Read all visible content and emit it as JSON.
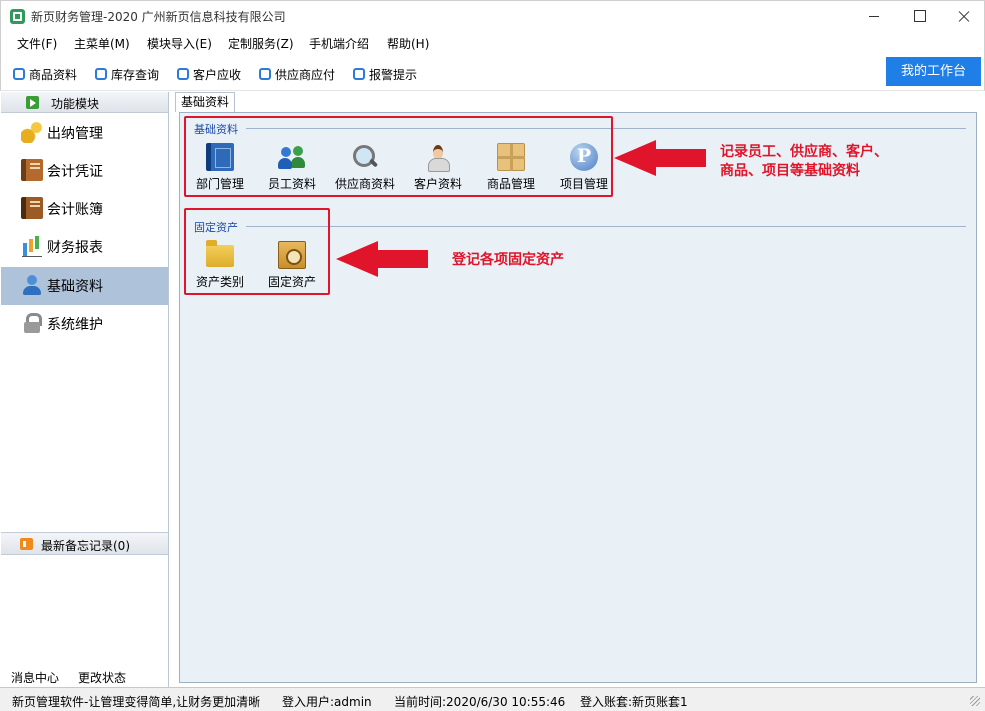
{
  "window": {
    "title": "新页财务管理-2020 广州新页信息科技有限公司"
  },
  "menu": [
    "文件(F)",
    "主菜单(M)",
    "模块导入(E)",
    "定制服务(Z)",
    "手机端介绍",
    "帮助(H)"
  ],
  "toolbar": {
    "quick_links": [
      "商品资料",
      "库存查询",
      "客户应收",
      "供应商应付",
      "报警提示"
    ],
    "workbench_label": "我的工作台"
  },
  "sidebar": {
    "header": "功能模块",
    "modules": [
      {
        "label": "出纳管理",
        "icon": "coins-icon"
      },
      {
        "label": "会计凭证",
        "icon": "voucher-book-icon"
      },
      {
        "label": "会计账簿",
        "icon": "ledger-book-icon"
      },
      {
        "label": "财务报表",
        "icon": "bar-chart-icon"
      },
      {
        "label": "基础资料",
        "icon": "user-icon",
        "active": true
      },
      {
        "label": "系统维护",
        "icon": "lock-icon"
      }
    ],
    "memo": "最新备忘记录(0)",
    "footer": {
      "messages": "消息中心",
      "status": "更改状态"
    }
  },
  "content": {
    "tab": "基础资料",
    "groups": [
      {
        "title": "基础资料",
        "items": [
          {
            "label": "部门管理",
            "icon": "department-book-icon"
          },
          {
            "label": "员工资料",
            "icon": "staff-group-icon"
          },
          {
            "label": "供应商资料",
            "icon": "supplier-search-icon"
          },
          {
            "label": "客户资料",
            "icon": "client-person-icon"
          },
          {
            "label": "商品管理",
            "icon": "goods-box-icon"
          },
          {
            "label": "项目管理",
            "icon": "project-p-icon"
          }
        ]
      },
      {
        "title": "固定资产",
        "items": [
          {
            "label": "资产类别",
            "icon": "folder-icon"
          },
          {
            "label": "固定资产",
            "icon": "safe-icon"
          }
        ]
      }
    ]
  },
  "annotations": {
    "basic_line1": "记录员工、供应商、客户、",
    "basic_line2": "商品、项目等基础资料",
    "assets": "登记各项固定资产",
    "color": "#e0142a"
  },
  "status": {
    "slogan": "新页管理软件-让管理变得简单,让财务更加清晰",
    "user": "登入用户:admin",
    "time": "当前时间:2020/6/30 10:55:46",
    "account": "登入账套:新页账套1"
  },
  "colors": {
    "accent": "#1f7fe6",
    "sidebar_active": "#aec2da",
    "content_bg": "#e9f1f7",
    "group_title": "#1a4aa8"
  }
}
